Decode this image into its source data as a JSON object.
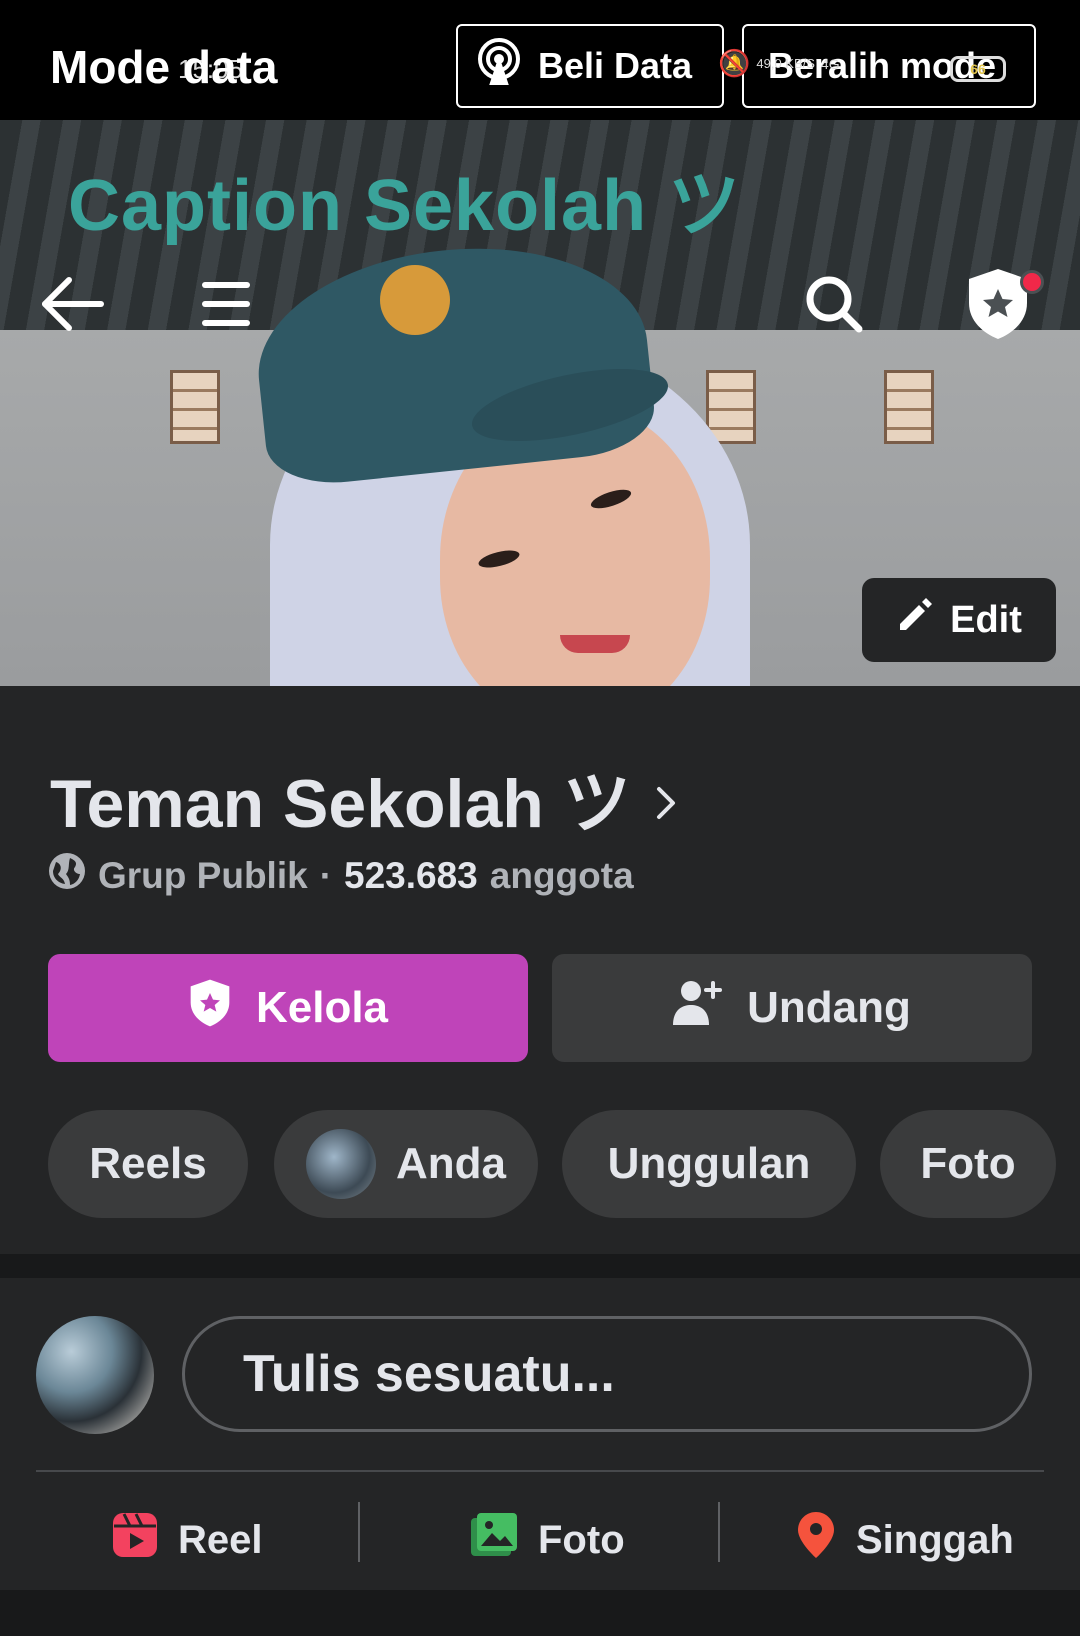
{
  "status_bar": {
    "mode_title": "Mode data",
    "clock": "15:05",
    "beli_data": "Beli Data",
    "beralih_mode": "Beralih mode",
    "net_speed": "49,0 KB/S",
    "network": "4G",
    "battery": "66"
  },
  "cover": {
    "caption": "Caption Sekolah ツ",
    "edit_label": "Edit"
  },
  "group": {
    "name": "Teman Sekolah ツ",
    "privacy": "Grup Publik",
    "separator": "·",
    "member_count": "523.683",
    "member_label": "anggota"
  },
  "actions": {
    "manage": "Kelola",
    "invite": "Undang"
  },
  "chips": [
    {
      "label": "Reels"
    },
    {
      "label": "Anda"
    },
    {
      "label": "Unggulan"
    },
    {
      "label": "Foto"
    }
  ],
  "composer": {
    "placeholder": "Tulis sesuatu..."
  },
  "post_options": {
    "reel": "Reel",
    "photo": "Foto",
    "checkin": "Singgah"
  },
  "colors": {
    "manage_button": "#bf44b9",
    "background": "#242526",
    "reel_icon": "#f3425f",
    "photo_icon": "#45bd62",
    "checkin_icon": "#f5533d",
    "notification_dot": "#f02849"
  }
}
